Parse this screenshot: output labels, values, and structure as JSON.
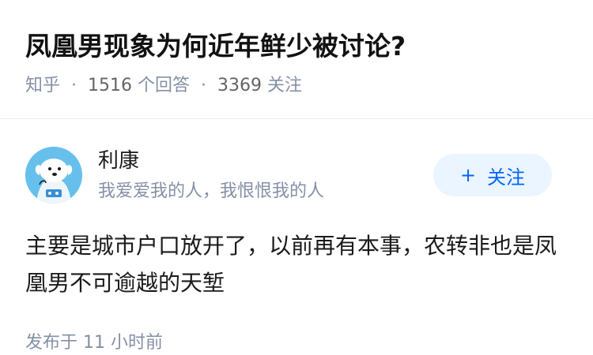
{
  "question": {
    "title": "凤凰男现象为何近年鲜少被讨论?",
    "source": "知乎",
    "answer_count": "1516",
    "answer_count_label": "个回答",
    "follow_count": "3369",
    "follow_count_label": "关注"
  },
  "author": {
    "name": "利康",
    "bio": "我爱爱我的人，我恨恨我的人",
    "avatar_icon": "dog-cartoon-avatar",
    "follow_button": {
      "icon": "+",
      "label": "关注"
    }
  },
  "answer": {
    "content": "主要是城市户口放开了，以前再有本事，农转非也是凤凰男不可逾越的天堑",
    "published_prefix": "发布于",
    "published_time": "11 小时前"
  },
  "colors": {
    "accent": "#0066ff",
    "meta_gray": "#8590a6",
    "follow_bg": "#ebf5ff",
    "avatar_bg": "#67c0ec"
  }
}
